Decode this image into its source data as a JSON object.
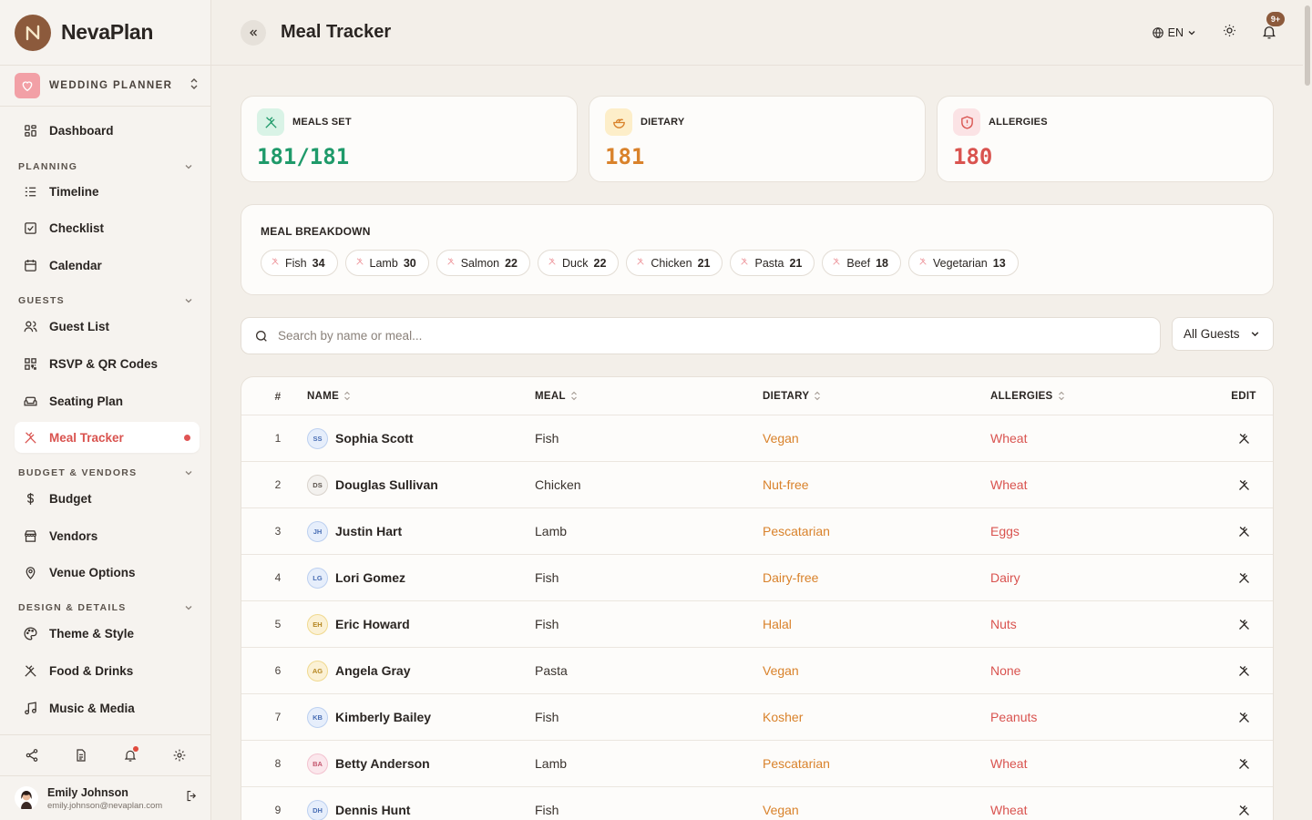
{
  "brand": {
    "name": "NevaPlan"
  },
  "workspace": {
    "label": "WEDDING PLANNER"
  },
  "nav": {
    "dashboard": "Dashboard",
    "planning_head": "PLANNING",
    "timeline": "Timeline",
    "checklist": "Checklist",
    "calendar": "Calendar",
    "guests_head": "GUESTS",
    "guest_list": "Guest List",
    "rsvp": "RSVP & QR Codes",
    "seating": "Seating Plan",
    "meal_tracker": "Meal Tracker",
    "budget_head": "BUDGET & VENDORS",
    "budget": "Budget",
    "vendors": "Vendors",
    "venue": "Venue Options",
    "design_head": "DESIGN & DETAILS",
    "theme": "Theme & Style",
    "food": "Food & Drinks",
    "music": "Music & Media"
  },
  "user": {
    "name": "Emily Johnson",
    "email": "emily.johnson@nevaplan.com"
  },
  "header": {
    "title": "Meal Tracker",
    "lang": "EN",
    "notif_badge": "9+"
  },
  "stats": {
    "meals_set_label": "MEALS SET",
    "meals_set_value": "181/181",
    "dietary_label": "DIETARY",
    "dietary_value": "181",
    "allergies_label": "ALLERGIES",
    "allergies_value": "180"
  },
  "colors": {
    "green": "#1f9a6a",
    "orange": "#d9822b",
    "red": "#d9534f",
    "brand": "#8c5a3c"
  },
  "breakdown": {
    "title": "MEAL BREAKDOWN",
    "chips": [
      {
        "name": "Fish",
        "count": "34"
      },
      {
        "name": "Lamb",
        "count": "30"
      },
      {
        "name": "Salmon",
        "count": "22"
      },
      {
        "name": "Duck",
        "count": "22"
      },
      {
        "name": "Chicken",
        "count": "21"
      },
      {
        "name": "Pasta",
        "count": "21"
      },
      {
        "name": "Beef",
        "count": "18"
      },
      {
        "name": "Vegetarian",
        "count": "13"
      }
    ]
  },
  "search": {
    "placeholder": "Search by name or meal..."
  },
  "filter": {
    "value": "All Guests"
  },
  "table": {
    "headers": {
      "num": "#",
      "name": "NAME",
      "meal": "MEAL",
      "dietary": "DIETARY",
      "allergies": "ALLERGIES",
      "edit": "EDIT"
    },
    "rows": [
      {
        "num": "1",
        "initials": "SS",
        "name": "Sophia Scott",
        "meal": "Fish",
        "dietary": "Vegan",
        "allergies": "Wheat"
      },
      {
        "num": "2",
        "initials": "DS",
        "name": "Douglas Sullivan",
        "meal": "Chicken",
        "dietary": "Nut-free",
        "allergies": "Wheat"
      },
      {
        "num": "3",
        "initials": "JH",
        "name": "Justin Hart",
        "meal": "Lamb",
        "dietary": "Pescatarian",
        "allergies": "Eggs"
      },
      {
        "num": "4",
        "initials": "LG",
        "name": "Lori Gomez",
        "meal": "Fish",
        "dietary": "Dairy-free",
        "allergies": "Dairy"
      },
      {
        "num": "5",
        "initials": "EH",
        "name": "Eric Howard",
        "meal": "Fish",
        "dietary": "Halal",
        "allergies": "Nuts"
      },
      {
        "num": "6",
        "initials": "AG",
        "name": "Angela Gray",
        "meal": "Pasta",
        "dietary": "Vegan",
        "allergies": "None"
      },
      {
        "num": "7",
        "initials": "KB",
        "name": "Kimberly Bailey",
        "meal": "Fish",
        "dietary": "Kosher",
        "allergies": "Peanuts"
      },
      {
        "num": "8",
        "initials": "BA",
        "name": "Betty Anderson",
        "meal": "Lamb",
        "dietary": "Pescatarian",
        "allergies": "Wheat"
      },
      {
        "num": "9",
        "initials": "DH",
        "name": "Dennis Hunt",
        "meal": "Fish",
        "dietary": "Vegan",
        "allergies": "Wheat"
      }
    ]
  }
}
